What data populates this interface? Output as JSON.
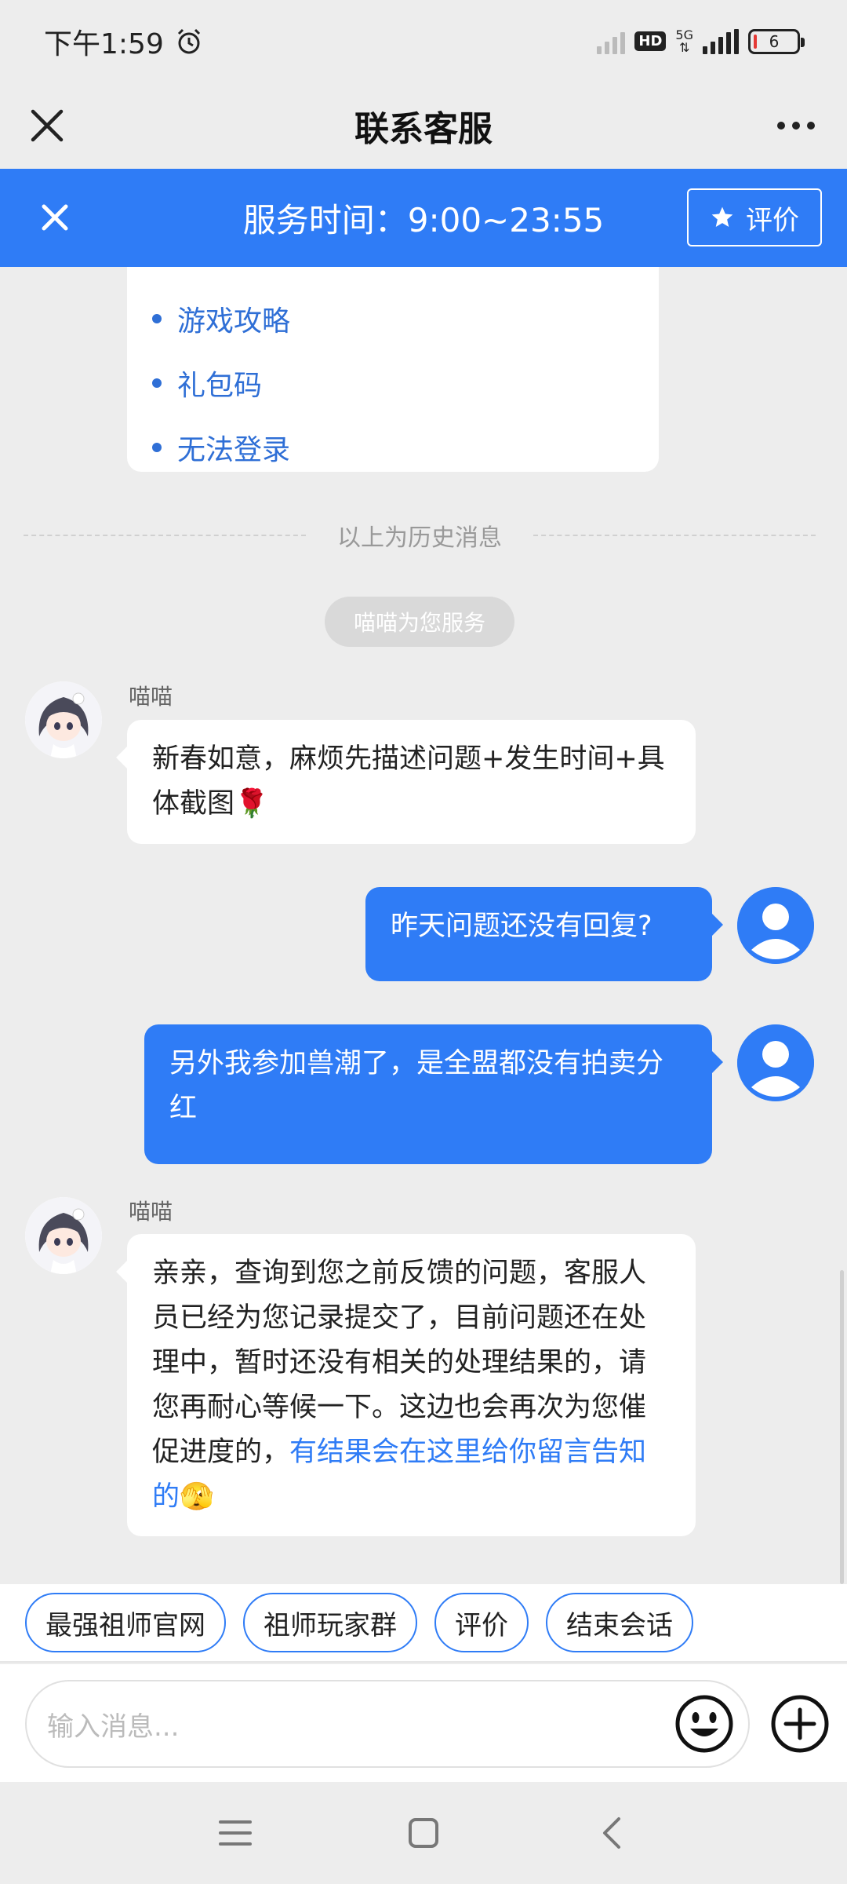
{
  "status_bar": {
    "time": "下午1:59",
    "hd_label": "HD",
    "network_label": "5G",
    "battery_level": "6"
  },
  "header": {
    "title": "联系客服"
  },
  "banner": {
    "service_time": "服务时间：9:00~23:55",
    "rate_label": "评价"
  },
  "menu": {
    "items": [
      {
        "label": "游戏攻略"
      },
      {
        "label": "礼包码"
      },
      {
        "label": "无法登录"
      }
    ]
  },
  "history_divider": "以上为历史消息",
  "system_notice": "喵喵为您服务",
  "messages": [
    {
      "sender": "喵喵",
      "text": "新春如意，麻烦先描述问题+发生时间+具体截图🌹"
    },
    {
      "text": "昨天问题还没有回复?"
    },
    {
      "text": "另外我参加兽潮了，是全盟都没有拍卖分红"
    },
    {
      "sender": "喵喵",
      "text_plain": "亲亲，查询到您之前反馈的问题，客服人员已经为您记录提交了，目前问题还在处理中，暂时还没有相关的处理结果的，请您再耐心等候一下。这边也会再次为您催促进度的，",
      "text_link": "有结果会在这里给你留言告知的",
      "emoji": "🫣"
    }
  ],
  "quick_actions": [
    {
      "label": "最强祖师官网"
    },
    {
      "label": "祖师玩家群"
    },
    {
      "label": "评价"
    },
    {
      "label": "结束会话"
    }
  ],
  "input": {
    "placeholder": "输入消息..."
  },
  "colors": {
    "accent": "#2f7cf6",
    "link": "#2f6fd6",
    "background": "#ededed"
  }
}
